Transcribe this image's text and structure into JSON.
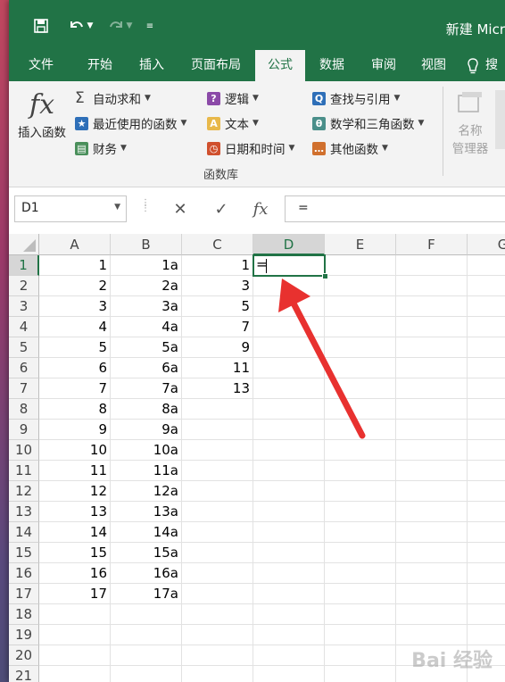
{
  "window": {
    "title": "新建 Micr"
  },
  "quick_access": {
    "save_icon": "save-icon",
    "undo_icon": "undo-icon",
    "redo_icon": "redo-icon",
    "customize_icon": "customize-icon"
  },
  "tabs": [
    {
      "label": "文件",
      "active": false
    },
    {
      "label": "开始",
      "active": false
    },
    {
      "label": "插入",
      "active": false
    },
    {
      "label": "页面布局",
      "active": false
    },
    {
      "label": "公式",
      "active": true
    },
    {
      "label": "数据",
      "active": false
    },
    {
      "label": "审阅",
      "active": false
    },
    {
      "label": "视图",
      "active": false
    },
    {
      "label": "搜",
      "active": false
    }
  ],
  "ribbon": {
    "insert_function": {
      "label": "插入函数",
      "icon": "fx"
    },
    "col1": [
      "自动求和",
      "最近使用的函数",
      "财务"
    ],
    "col2": [
      "逻辑",
      "文本",
      "日期和时间"
    ],
    "col3": [
      "查找与引用",
      "数学和三角函数",
      "其他函数"
    ],
    "col2_icons": [
      "?",
      "A",
      "◷"
    ],
    "col3_icons": [
      "Q",
      "θ",
      "…"
    ],
    "group_label": "函数库",
    "name_manager": {
      "line1": "名称",
      "line2": "管理器"
    }
  },
  "formula_bar": {
    "name_box": "D1",
    "cancel_icon": "✕",
    "enter_icon": "✓",
    "fx_icon": "fx",
    "content": "="
  },
  "sheet": {
    "columns": [
      "A",
      "B",
      "C",
      "D",
      "E",
      "F",
      "G"
    ],
    "selected_column": "D",
    "selected_row": 1,
    "rows": [
      {
        "n": "1",
        "a": "1",
        "b": "1a",
        "c": "1"
      },
      {
        "n": "2",
        "a": "2",
        "b": "2a",
        "c": "3"
      },
      {
        "n": "3",
        "a": "3",
        "b": "3a",
        "c": "5"
      },
      {
        "n": "4",
        "a": "4",
        "b": "4a",
        "c": "7"
      },
      {
        "n": "5",
        "a": "5",
        "b": "5a",
        "c": "9"
      },
      {
        "n": "6",
        "a": "6",
        "b": "6a",
        "c": "11"
      },
      {
        "n": "7",
        "a": "7",
        "b": "7a",
        "c": "13"
      },
      {
        "n": "8",
        "a": "8",
        "b": "8a",
        "c": ""
      },
      {
        "n": "9",
        "a": "9",
        "b": "9a",
        "c": ""
      },
      {
        "n": "10",
        "a": "10",
        "b": "10a",
        "c": ""
      },
      {
        "n": "11",
        "a": "11",
        "b": "11a",
        "c": ""
      },
      {
        "n": "12",
        "a": "12",
        "b": "12a",
        "c": ""
      },
      {
        "n": "13",
        "a": "13",
        "b": "13a",
        "c": ""
      },
      {
        "n": "14",
        "a": "14",
        "b": "14a",
        "c": ""
      },
      {
        "n": "15",
        "a": "15",
        "b": "15a",
        "c": ""
      },
      {
        "n": "16",
        "a": "16",
        "b": "16a",
        "c": ""
      },
      {
        "n": "17",
        "a": "17",
        "b": "17a",
        "c": ""
      },
      {
        "n": "18",
        "a": "",
        "b": "",
        "c": ""
      },
      {
        "n": "19",
        "a": "",
        "b": "",
        "c": ""
      },
      {
        "n": "20",
        "a": "",
        "b": "",
        "c": ""
      },
      {
        "n": "21",
        "a": "",
        "b": "",
        "c": ""
      }
    ],
    "active_cell_value": "="
  },
  "annotation": {
    "arrow_color": "#e8312f"
  },
  "watermark": "Bai 经验",
  "colors": {
    "excel_green": "#217346",
    "ribbon_bg": "#f3f3f3"
  }
}
